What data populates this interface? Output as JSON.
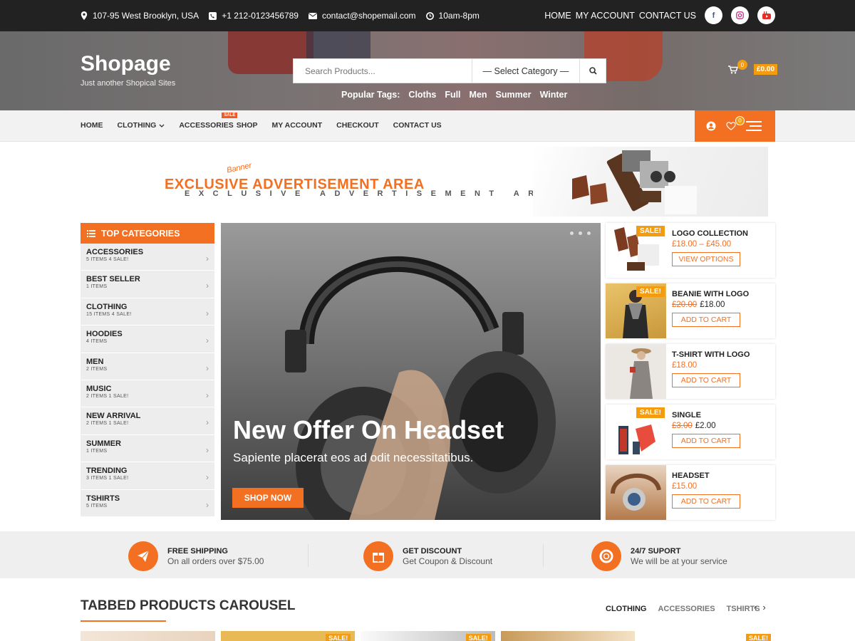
{
  "topbar": {
    "address": "107-95 West Brooklyn, USA",
    "phone": "+1 212-0123456789",
    "email": "contact@shopemail.com",
    "hours": "10am-8pm",
    "links": [
      "HOME",
      "MY ACCOUNT",
      "CONTACT US"
    ],
    "social": [
      "facebook-icon",
      "instagram-icon",
      "youtube-icon"
    ]
  },
  "header": {
    "logo": "Shopage",
    "tagline": "Just another Shopical Sites",
    "search_placeholder": "Search Products...",
    "category_select": "— Select Category —",
    "popular_label": "Popular Tags:",
    "popular_tags": [
      "Cloths",
      "Full",
      "Men",
      "Summer",
      "Winter"
    ],
    "cart_count": "0",
    "cart_total": "£0.00"
  },
  "nav": {
    "items": [
      "HOME",
      "CLOTHING",
      "ACCESSORIES",
      "SHOP",
      "MY ACCOUNT",
      "CHECKOUT",
      "CONTACT US"
    ],
    "sale_tag": "SALE",
    "wishlist_count": "0"
  },
  "banner": {
    "small": "Banner",
    "main": "EXCLUSIVE ADVERTISEMENT AREA",
    "sub": "EXCLUSIVE ADVERTISEMENT AREA"
  },
  "categories": {
    "title": "TOP CATEGORIES",
    "items": [
      {
        "name": "ACCESSORIES",
        "meta": "5 ITEMS   4 SALE!"
      },
      {
        "name": "BEST SELLER",
        "meta": "1 ITEMS"
      },
      {
        "name": "CLOTHING",
        "meta": "15 ITEMS   4 SALE!"
      },
      {
        "name": "HOODIES",
        "meta": "4 ITEMS"
      },
      {
        "name": "MEN",
        "meta": "2 ITEMS"
      },
      {
        "name": "MUSIC",
        "meta": "2 ITEMS   1 SALE!"
      },
      {
        "name": "NEW ARRIVAL",
        "meta": "2 ITEMS   1 SALE!"
      },
      {
        "name": "SUMMER",
        "meta": "1 ITEMS"
      },
      {
        "name": "TRENDING",
        "meta": "3 ITEMS   1 SALE!"
      },
      {
        "name": "TSHIRTS",
        "meta": "5 ITEMS"
      }
    ]
  },
  "slider": {
    "title": "New Offer On Headset",
    "subtitle": "Sapiente placerat eos ad odit necessitatibus.",
    "button": "SHOP NOW"
  },
  "products": [
    {
      "name": "LOGO COLLECTION",
      "price": "£18.00 – £45.00",
      "old": "",
      "new": "",
      "button": "VIEW OPTIONS",
      "sale": "SALE!"
    },
    {
      "name": "BEANIE WITH LOGO",
      "price": "",
      "old": "£20.00",
      "new": "£18.00",
      "button": "ADD TO CART",
      "sale": "SALE!"
    },
    {
      "name": "T-SHIRT WITH LOGO",
      "price": "£18.00",
      "old": "",
      "new": "",
      "button": "ADD TO CART",
      "sale": ""
    },
    {
      "name": "SINGLE",
      "price": "",
      "old": "£3.00",
      "new": "£2.00",
      "button": "ADD TO CART",
      "sale": "SALE!"
    },
    {
      "name": "HEADSET",
      "price": "£15.00",
      "old": "",
      "new": "",
      "button": "ADD TO CART",
      "sale": ""
    }
  ],
  "features": [
    {
      "title": "FREE SHIPPING",
      "desc": "On all orders over $75.00",
      "icon": "paper-plane-icon"
    },
    {
      "title": "GET DISCOUNT",
      "desc": "Get Coupon & Discount",
      "icon": "gift-icon"
    },
    {
      "title": "24/7 SUPORT",
      "desc": "We will be at your service",
      "icon": "lifebuoy-icon"
    }
  ],
  "tabbed": {
    "title": "TABBED PRODUCTS CAROUSEL",
    "tabs": [
      "CLOTHING",
      "ACCESSORIES",
      "TSHIRTS"
    ],
    "sale": "SALE!"
  },
  "colors": {
    "accent": "#f36f21",
    "badge": "#f39c12",
    "dark": "#222222"
  }
}
